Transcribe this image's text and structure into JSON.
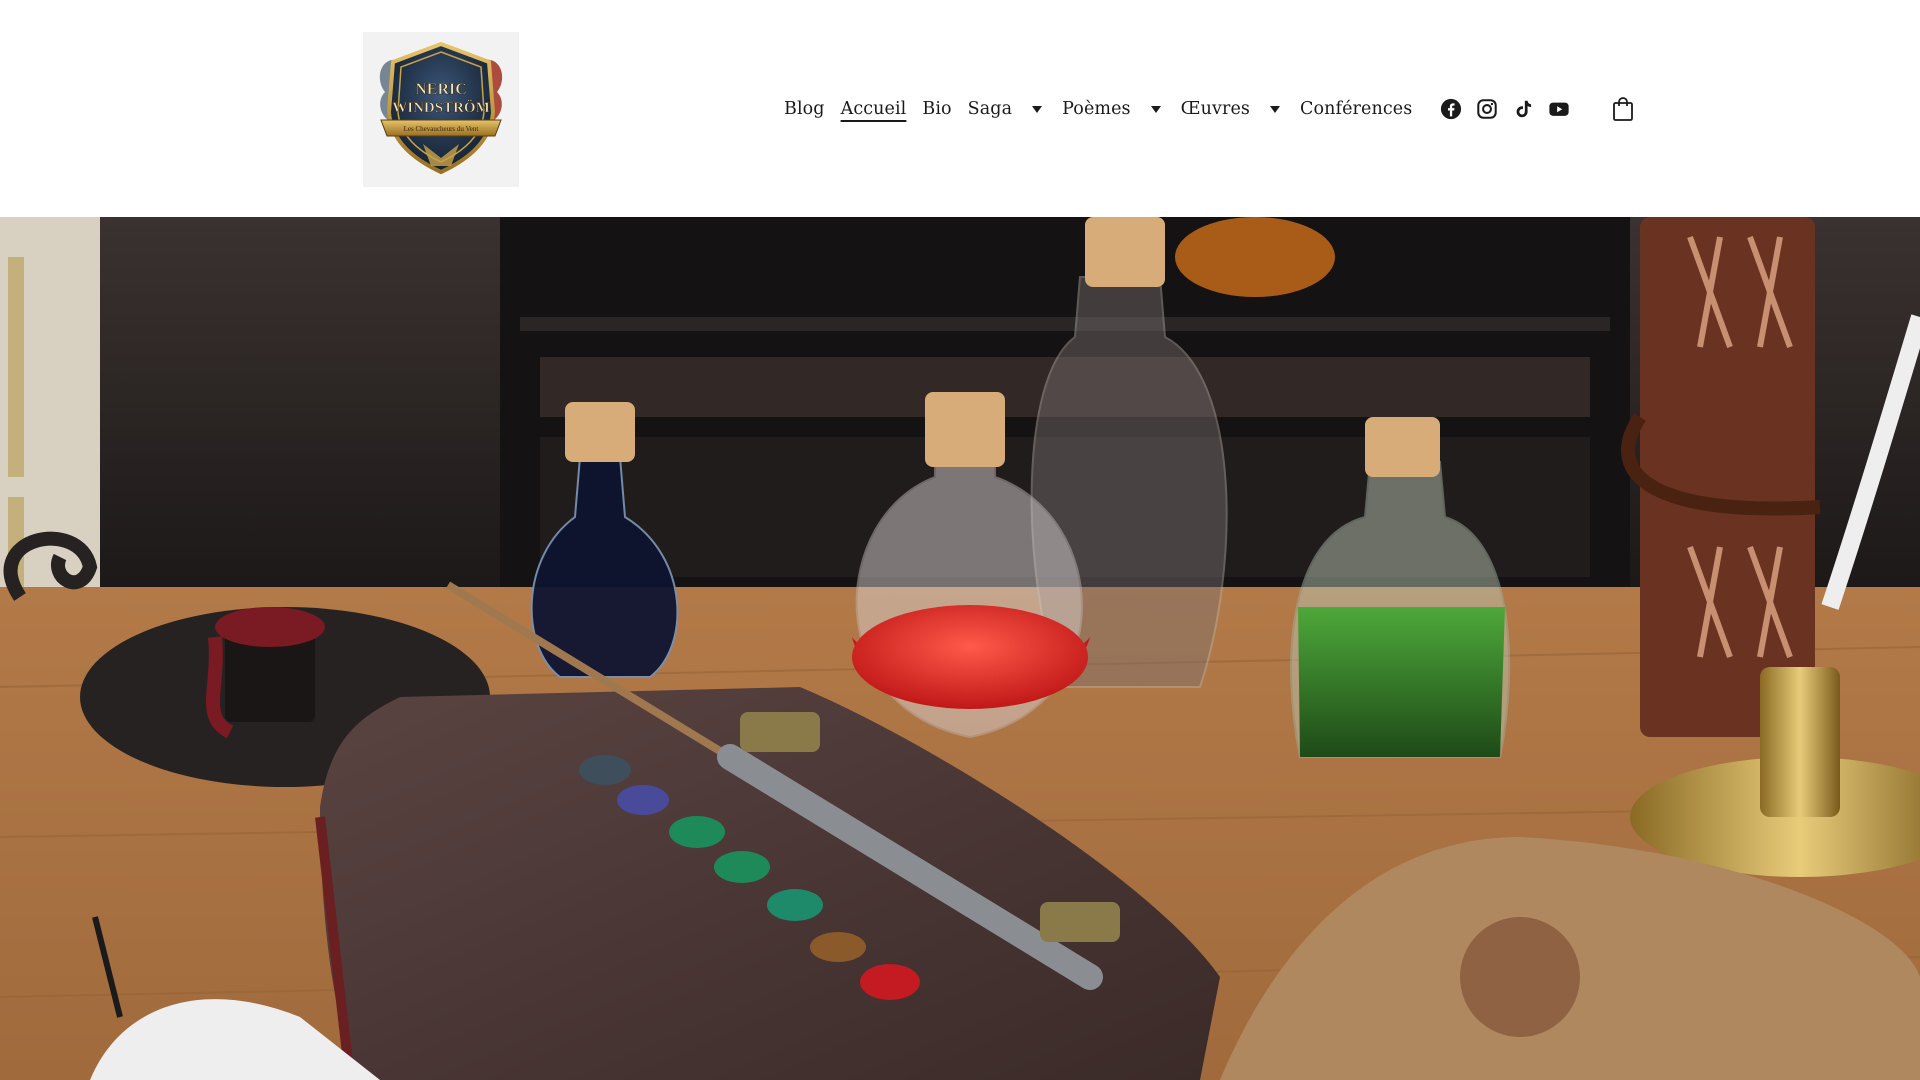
{
  "logo": {
    "line1": "NERIC",
    "line2": "WINDSTRÖM",
    "banner": "Les Chevaucheurs du Vent"
  },
  "nav": {
    "items": [
      {
        "label": "Blog",
        "has_dropdown": false,
        "active": false
      },
      {
        "label": "Accueil",
        "has_dropdown": false,
        "active": true
      },
      {
        "label": "Bio",
        "has_dropdown": false,
        "active": false
      },
      {
        "label": "Saga",
        "has_dropdown": true,
        "active": false
      },
      {
        "label": "Poèmes",
        "has_dropdown": true,
        "active": false
      },
      {
        "label": "Œuvres",
        "has_dropdown": true,
        "active": false
      },
      {
        "label": "Conférences",
        "has_dropdown": false,
        "active": false
      }
    ]
  },
  "socials": [
    "facebook-icon",
    "instagram-icon",
    "tiktok-icon",
    "youtube-icon"
  ],
  "cart": {
    "icon": "shopping-bag-icon"
  },
  "hero": {
    "image": "alchemy-desk-photo"
  },
  "colors": {
    "text": "#1a1a1a",
    "background": "#ffffff"
  }
}
